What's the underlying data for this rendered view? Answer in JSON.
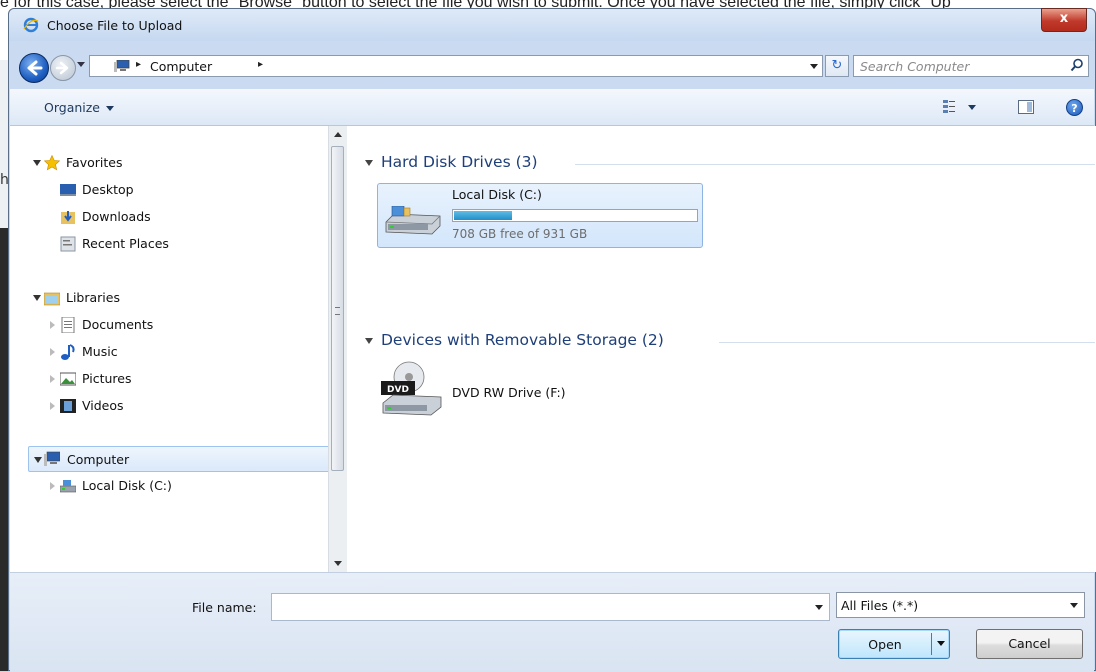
{
  "background": {
    "text": "e for this case, please select the \"Browse\" button to select the file you wish to submit. Once you have selected the file, simply click \"Up",
    "fragment": "hi"
  },
  "dialog": {
    "title": "Choose File to Upload",
    "close_label": "x"
  },
  "address_bar": {
    "path": [
      "Computer"
    ],
    "separator": "▸"
  },
  "search": {
    "placeholder": "Search Computer"
  },
  "command_bar": {
    "organize_label": "Organize",
    "help_label": "?"
  },
  "nav_pane": {
    "favorites": {
      "label": "Favorites",
      "items": [
        "Desktop",
        "Downloads",
        "Recent Places"
      ]
    },
    "libraries": {
      "label": "Libraries",
      "items": [
        "Documents",
        "Music",
        "Pictures",
        "Videos"
      ]
    },
    "computer": {
      "label": "Computer",
      "items": [
        "Local Disk (C:)"
      ]
    }
  },
  "content": {
    "groups": [
      {
        "title": "Hard Disk Drives (3)",
        "items": [
          {
            "name": "Local Disk (C:)",
            "free_text": "708 GB free of 931 GB",
            "used_fraction": 0.24
          }
        ]
      },
      {
        "title": "Devices with Removable Storage (2)",
        "items": [
          {
            "name": "DVD RW Drive (F:)",
            "badge": "DVD"
          }
        ]
      }
    ]
  },
  "bottom": {
    "file_name_label": "File name:",
    "file_name_value": "",
    "filter_value": "All Files (*.*)",
    "open_label": "Open",
    "cancel_label": "Cancel"
  }
}
